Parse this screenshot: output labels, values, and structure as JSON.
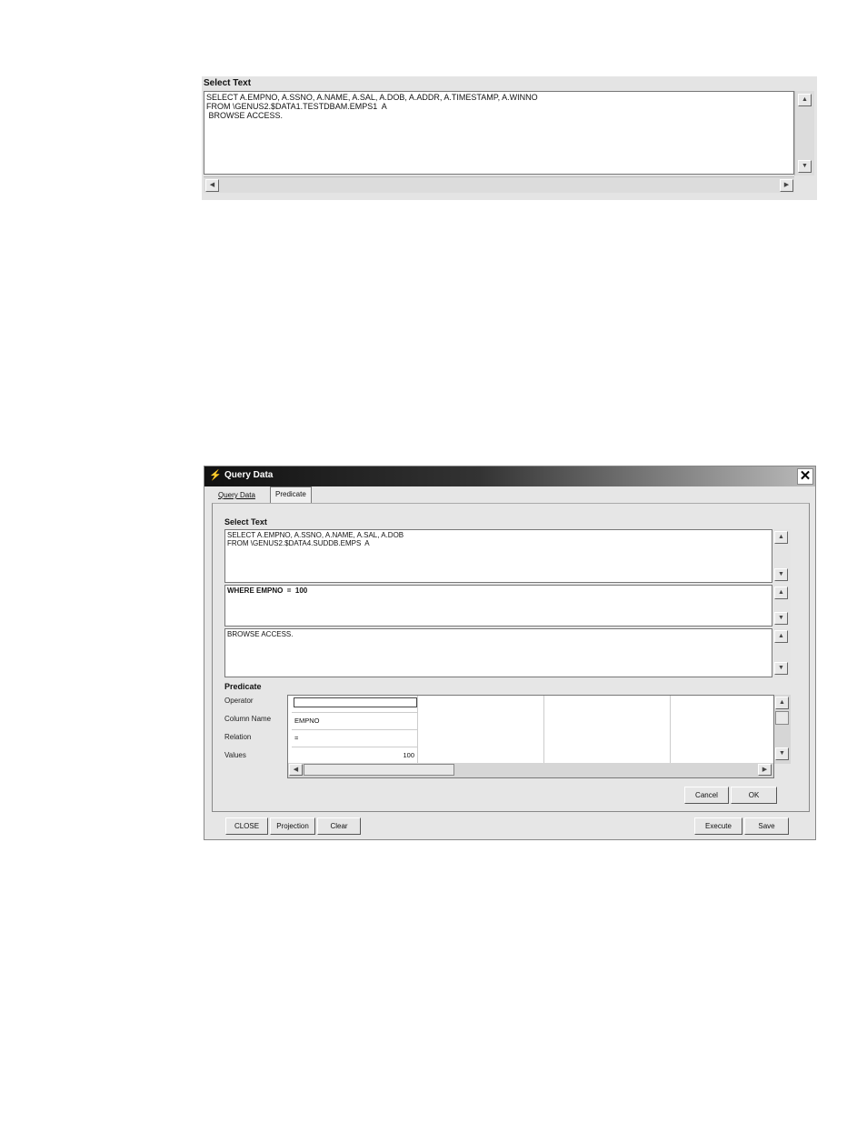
{
  "panel1": {
    "title": "Select Text",
    "sql_line1": "SELECT A.EMPNO, A.SSNO, A.NAME, A.SAL, A.DOB, A.ADDR, A.TIMESTAMP, A.WINNO",
    "sql_line2": "FROM \\GENUS2.$DATA1.TESTDBAM.EMPS1  A",
    "sql_line3": " BROWSE ACCESS."
  },
  "dialog": {
    "title": "Query Data",
    "tabs": [
      "Query Data",
      "Predicate"
    ],
    "select_text_label": "Select Text",
    "select_line1": "SELECT A.EMPNO, A.SSNO, A.NAME, A.SAL, A.DOB",
    "select_line2": "FROM \\GENUS2.$DATA4.SUDDB.EMPS  A",
    "where_text": "WHERE EMPNO  =  100",
    "browse_text": "BROWSE ACCESS.",
    "predicate_label": "Predicate",
    "row_labels": [
      "Operator",
      "Column Name",
      "Relation",
      "Values"
    ],
    "grid": {
      "column_name_value": "EMPNO",
      "relation_value": "=",
      "values_value": "100"
    },
    "buttons": {
      "cancel": "Cancel",
      "ok": "OK",
      "close": "CLOSE",
      "projection": "Projection",
      "clear": "Clear",
      "execute": "Execute",
      "save": "Save"
    },
    "close_glyph": "✕",
    "icons": {
      "app": "query-app-icon",
      "close": "close-icon"
    }
  }
}
